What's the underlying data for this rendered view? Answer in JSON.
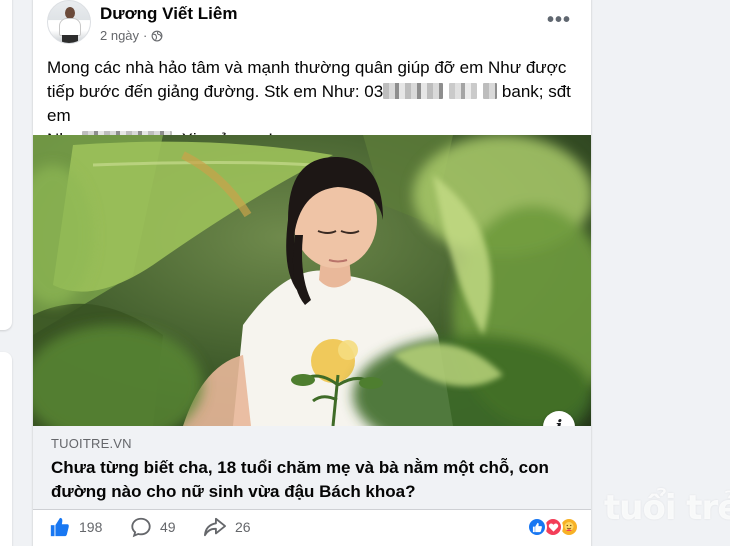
{
  "post": {
    "author": "Dương Viết Liêm",
    "time": "2 ngày",
    "separator": "·",
    "more_label": "•••",
    "text_line1": "Mong các nhà hảo tâm và mạnh thường quân giúp đỡ em Như  được",
    "text_line2_a": "tiếp bước đến giảng đường. Stk em Như: 03",
    "text_line2_b": "bank; sđt em",
    "text_line3_a": "Như",
    "text_line3_b": ". Xin cảm ơn!"
  },
  "link": {
    "domain": "TUOITRE.VN",
    "title": "Chưa từng biết cha, 18 tuổi chăm mẹ và bà nằm một chỗ, con đường nào cho nữ sinh vừa đậu Bách khoa?",
    "info_label": "i"
  },
  "stats": {
    "likes": "198",
    "comments": "49",
    "shares": "26"
  },
  "icons": {
    "like": "thumbs-up-icon",
    "comment": "comment-icon",
    "share": "share-icon",
    "privacy": "globe-icon"
  },
  "colors": {
    "like_blue": "#1877f2",
    "love_red": "#f33e58",
    "care_yellow": "#f7b125"
  },
  "watermark": "tuổi trẻ"
}
